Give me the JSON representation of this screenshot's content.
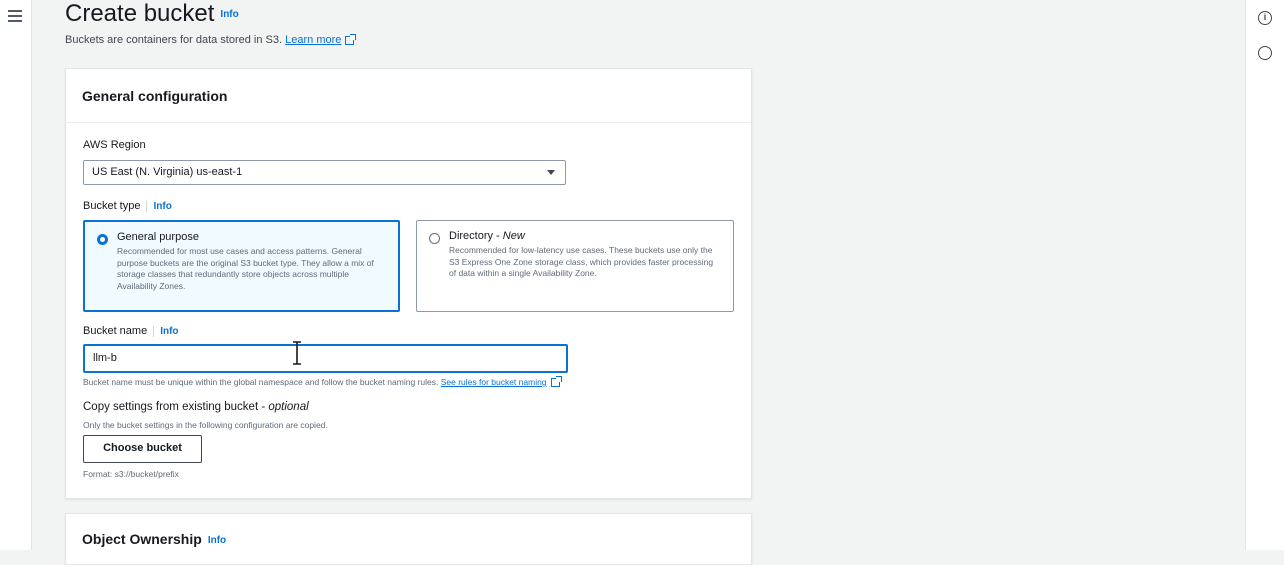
{
  "page": {
    "title": "Create bucket",
    "title_info": "Info",
    "subtitle": "Buckets are containers for data stored in S3.",
    "learn_more": "Learn more"
  },
  "general": {
    "header": "General configuration",
    "region_label": "AWS Region",
    "region_value": "US East (N. Virginia) us-east-1",
    "bucket_type_label": "Bucket type",
    "bucket_type_info": "Info",
    "options": [
      {
        "title": "General purpose",
        "desc": "Recommended for most use cases and access patterns. General purpose buckets are the original S3 bucket type. They allow a mix of storage classes that redundantly store objects across multiple Availability Zones.",
        "selected": true
      },
      {
        "title": "Directory - ",
        "title_suffix": "New",
        "desc": "Recommended for low-latency use cases. These buckets use only the S3 Express One Zone storage class, which provides faster processing of data within a single Availability Zone.",
        "selected": false
      }
    ],
    "bucket_name_label": "Bucket name",
    "bucket_name_info": "Info",
    "bucket_name_value": "llm-b",
    "bucket_name_helper": "Bucket name must be unique within the global namespace and follow the bucket naming rules.",
    "bucket_name_rules_link": "See rules for bucket naming",
    "copy_label": "Copy settings from existing bucket - ",
    "copy_optional": "optional",
    "copy_desc": "Only the bucket settings in the following configuration are copied.",
    "choose_button": "Choose bucket",
    "format_hint": "Format: s3://bucket/prefix"
  },
  "ownership": {
    "header": "Object Ownership",
    "info": "Info"
  },
  "colors": {
    "accent": "#0972d3",
    "selected_bg": "#f1faff"
  }
}
